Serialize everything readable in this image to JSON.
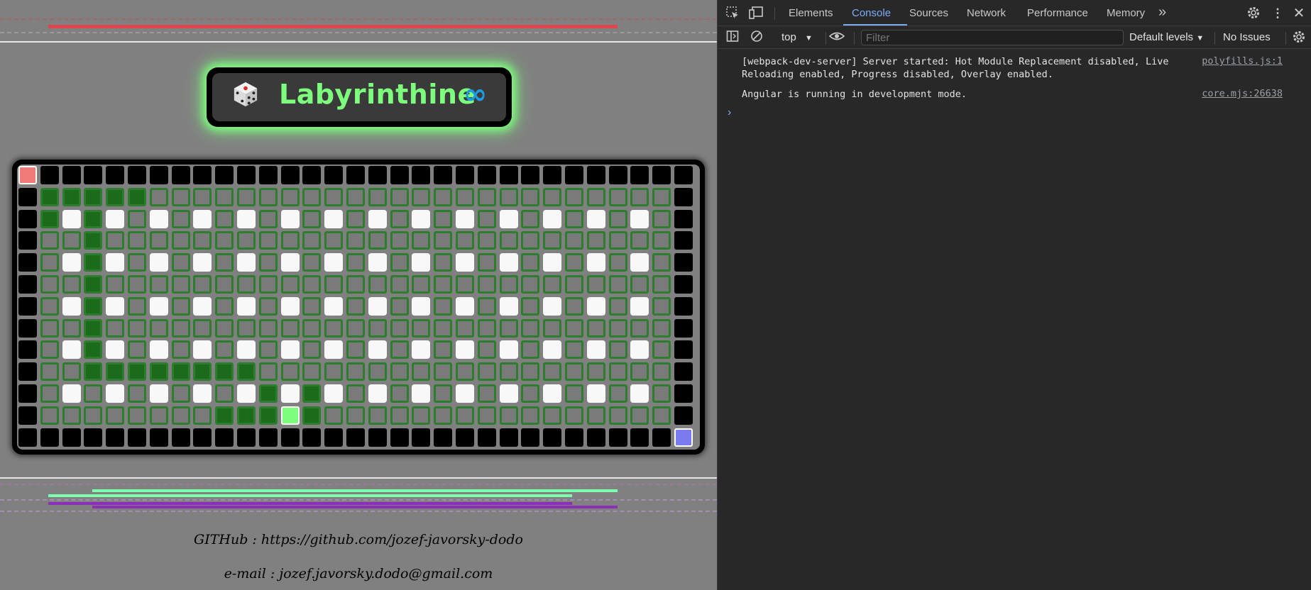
{
  "app": {
    "title": "Labyrinthine",
    "dice_icon": "dice-icon",
    "infinity_icon": "infinity-icon",
    "infinity_glyph": "∞",
    "colors": {
      "title": "#7dff7d",
      "glow": "#7dff7d",
      "infinity": "#1e9ae0",
      "start": "#f07b7b",
      "end": "#7b7bf0",
      "player": "#7dff7d",
      "visited": "#1b6b1b",
      "path_border": "#2e7d2e"
    },
    "maze": {
      "rows": [
        "SWWWWWWWWWWWWWWWWWWWWWWWWWWWWWW",
        "WVVVVVPPPPPPPPPPPPPPPPPPPPPPPPW",
        "WVBVBPBPBPBPBPBPBPBPBPBPBPBPBPW",
        "WPPVPPPPPPPPPPPPPPPPPPPPPPPPPPW",
        "WPBVBPBPBPBPBPBPBPBPBPBPBPBPBPW",
        "WPPVPPPPPPPPPPPPPPPPPPPPPPPPPPW",
        "WPBVBPBPBPBPBPBPBPBPBPBPBPBPBPW",
        "WPPVPPPPPPPPPPPPPPPPPPPPPPPPPPW",
        "WPBVBPBPBPBPBPBPBPBPBPBPBPBPBPW",
        "WPPVVVVVVVVPPPPPPPPPPPPPPPPPPPW",
        "WPBPBPBPBPBVBVBPBPBPBPBPBPBPBPW",
        "WPPPPPPPPVVVXVPPPPPPPPPPPPPPPPW",
        "WWWWWWWWWWWWWWWWWWWWWWWWWWWWWWE"
      ]
    },
    "footer": {
      "github": "GITHub : https://github.com/jozef-javorsky-dodo",
      "email": "e-mail : jozef.javorsky.dodo@gmail.com"
    }
  },
  "devtools": {
    "tabs": [
      {
        "label": "Elements",
        "active": false
      },
      {
        "label": "Console",
        "active": true
      },
      {
        "label": "Sources",
        "active": false
      },
      {
        "label": "Network",
        "active": false
      },
      {
        "label": "Performance",
        "active": false
      },
      {
        "label": "Memory",
        "active": false
      }
    ],
    "more_tabs_glyph": "»",
    "context": "top",
    "filter_placeholder": "Filter",
    "levels": "Default levels",
    "issues": "No Issues",
    "messages": [
      {
        "text_line1": "[webpack-dev-server] Server started: Hot Module Replacement disabled, Live",
        "text_line2": "Reloading enabled, Progress disabled, Overlay enabled.",
        "source": "polyfills.js:1"
      },
      {
        "text_line1": "Angular is running in development mode.",
        "text_line2": "",
        "source": "core.mjs:26638"
      }
    ],
    "prompt_glyph": "›"
  }
}
